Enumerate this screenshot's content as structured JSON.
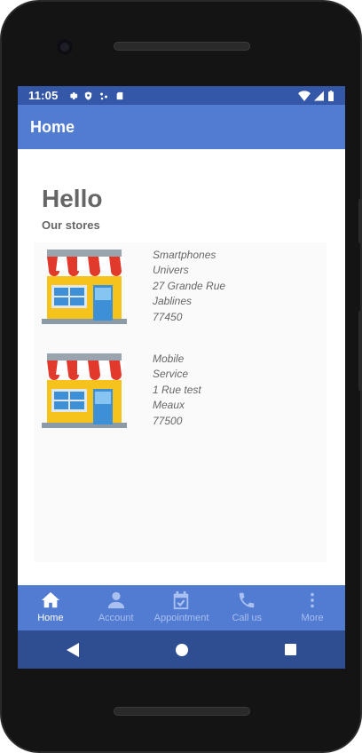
{
  "status_bar": {
    "time": "11:05"
  },
  "app_bar": {
    "title": "Home"
  },
  "content": {
    "greeting": "Hello",
    "section_title": "Our stores",
    "stores": [
      {
        "lines": [
          "Smartphones",
          "Univers",
          "27 Grande Rue",
          "Jablines",
          "77450"
        ]
      },
      {
        "lines": [
          "Mobile",
          "Service",
          "1 Rue test",
          "Meaux",
          "77500"
        ]
      }
    ]
  },
  "bottom_nav": {
    "items": [
      {
        "label": "Home",
        "icon": "home-icon",
        "active": true
      },
      {
        "label": "Account",
        "icon": "user-icon",
        "active": false
      },
      {
        "label": "Appointment",
        "icon": "calendar-check-icon",
        "active": false
      },
      {
        "label": "Call us",
        "icon": "phone-icon",
        "active": false
      },
      {
        "label": "More",
        "icon": "more-vertical-icon",
        "active": false
      }
    ]
  },
  "colors": {
    "status_bar": "#3457a8",
    "app_bar": "#527bd2",
    "bottom_nav": "#527bd2",
    "system_nav": "#2f4e92",
    "text_gray": "#666666"
  }
}
